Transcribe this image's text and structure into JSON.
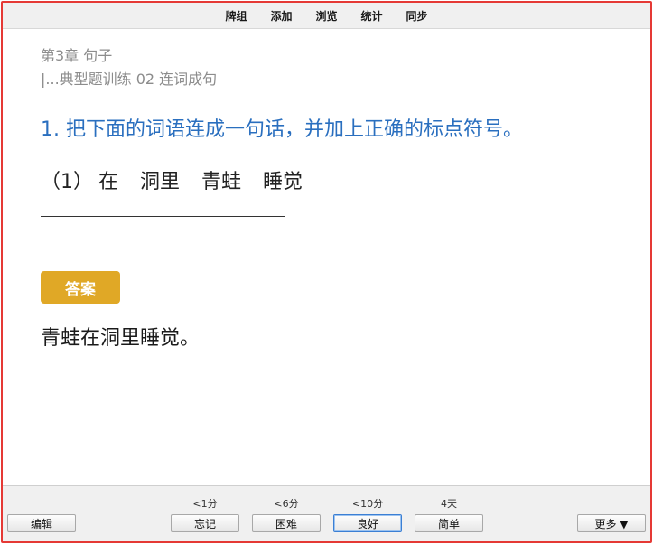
{
  "menu": {
    "items": [
      "牌组",
      "添加",
      "浏览",
      "统计",
      "同步"
    ]
  },
  "card": {
    "chapter": "第3章 句子",
    "subsection": "|...典型题训练 02 连词成句",
    "question": "1. 把下面的词语连成一句话，并加上正确的标点符号。",
    "subq_number": "（1）",
    "words": [
      "在",
      "洞里",
      "青蛙",
      "睡觉"
    ],
    "answer_label": "答案",
    "answer": "青蛙在洞里睡觉。"
  },
  "bottom": {
    "edit_label": "编辑",
    "more_label": "更多 ▼",
    "answers": [
      {
        "interval": "<1分",
        "label": "忘记"
      },
      {
        "interval": "<6分",
        "label": "困难"
      },
      {
        "interval": "<10分",
        "label": "良好"
      },
      {
        "interval": "4天",
        "label": "简单"
      }
    ]
  },
  "colors": {
    "frame_border": "#e53935",
    "question_blue": "#2a6fbf",
    "answer_badge": "#e0a826",
    "muted_text": "#8c8c8c"
  }
}
